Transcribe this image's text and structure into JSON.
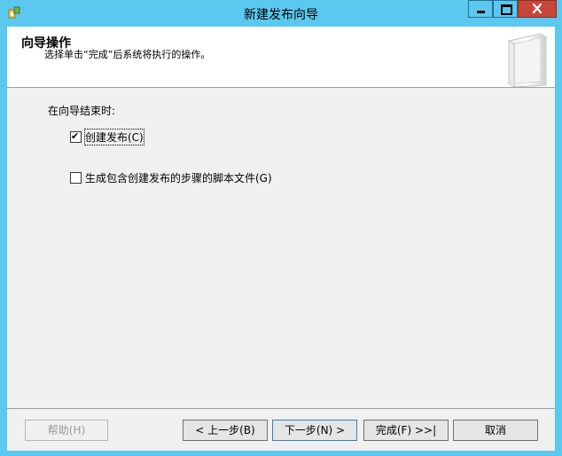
{
  "window": {
    "title": "新建发布向导"
  },
  "header": {
    "title": "向导操作",
    "description": "选择单击“完成”后系统将执行的操作。"
  },
  "main": {
    "actions_label": "在向导结束时:",
    "options": [
      {
        "label": "创建发布(C)",
        "checked": true
      },
      {
        "label": "生成包含创建发布的步骤的脚本文件(G)",
        "checked": false
      }
    ]
  },
  "buttons": {
    "help": "帮助(H)",
    "back": "< 上一步(B)",
    "next": "下一步(N) >",
    "finish": "完成(F) >>|",
    "cancel": "取消"
  },
  "colors": {
    "frame": "#5bc8f0",
    "close_button": "#c7463a",
    "client_background": "#f0f0f0"
  },
  "icons": {
    "app": "sql-server-icon",
    "header": "wizard-banner-graphic"
  }
}
